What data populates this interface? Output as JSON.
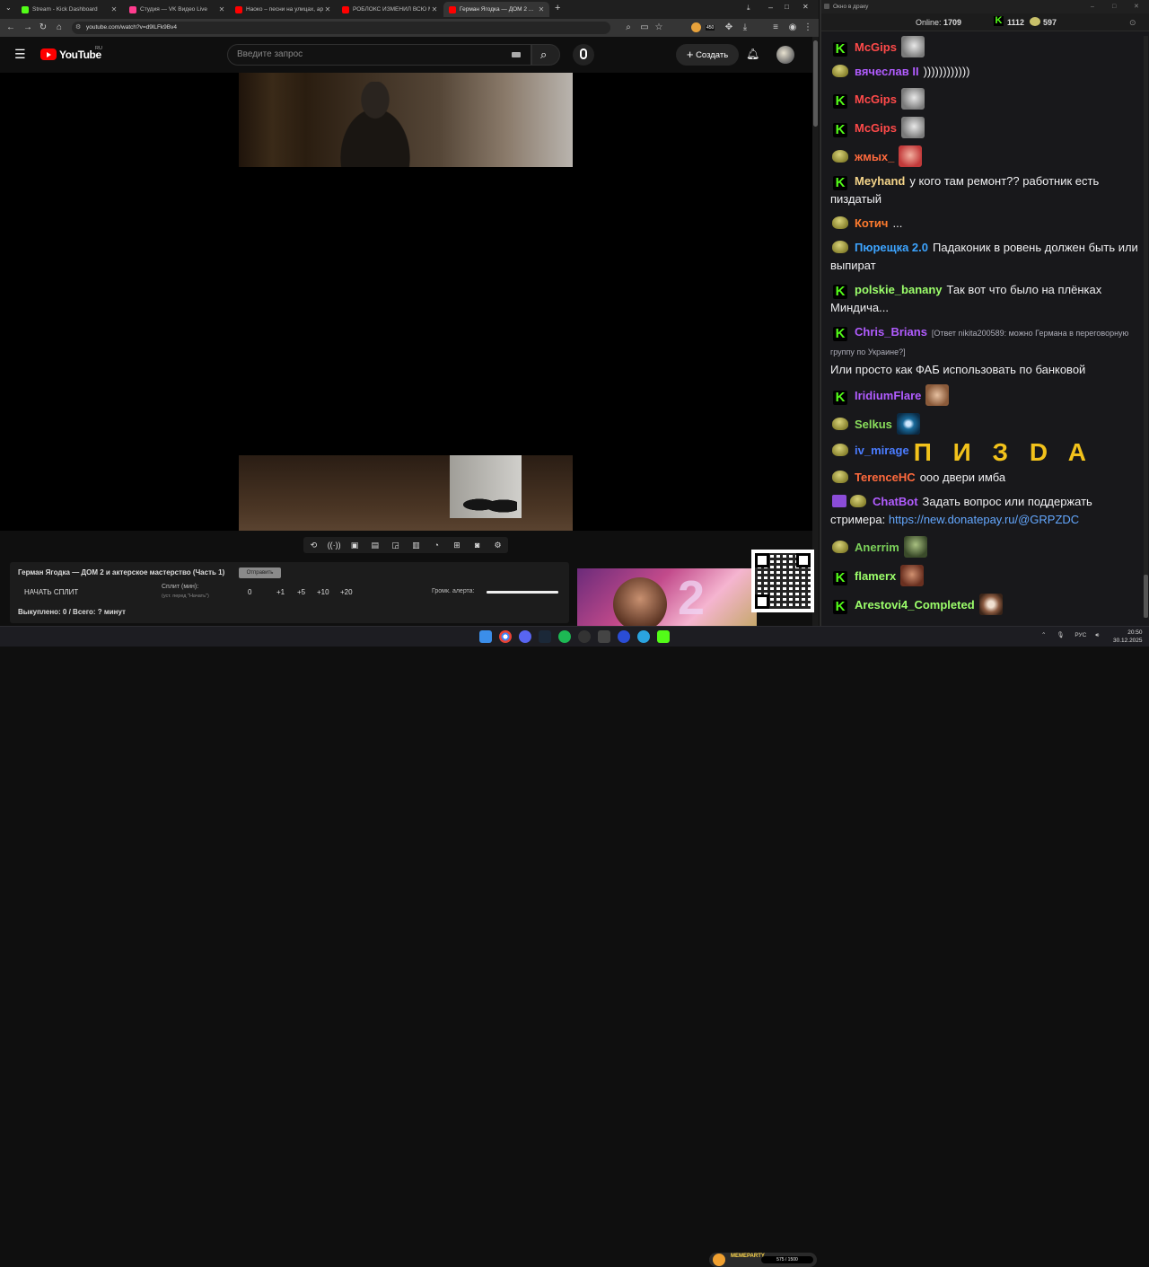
{
  "browser": {
    "tabs": [
      {
        "label": "Stream - Kick Dashboard",
        "icon": "kick-icon",
        "color": "#53fc18"
      },
      {
        "label": "Студия — VK Видео Live",
        "icon": "vk-video-icon",
        "color": "#ff3c8e"
      },
      {
        "label": "Наоко – песни на улицах, арс...",
        "icon": "youtube-icon",
        "color": "#ff0000"
      },
      {
        "label": "РОБЛОКС ИЗМЕНИЛ ВСЮ М...",
        "icon": "youtube-icon",
        "color": "#ff0000"
      },
      {
        "label": "Герман Ягодка — ДОМ 2 ...",
        "icon": "youtube-icon",
        "color": "#ff0000"
      }
    ],
    "url": "youtube.com/watch?v=d9lLFk9Bv4",
    "extension_badge": "450"
  },
  "youtube": {
    "wordmark": "YouTube",
    "region": "RU",
    "search_placeholder": "Введите запрос",
    "create_label": "Создать"
  },
  "split_panel": {
    "title": "Герман Ягодка — ДОМ 2 и актерское мастерство (Часть 1)",
    "title_button": "Отправить",
    "start_label": "НАЧАТЬ СПЛИТ",
    "split_label": "Сплит (мин):",
    "split_hint": "(уст. перед \"Начать\")",
    "split_value": "0",
    "increments": [
      "+1",
      "+5",
      "+10",
      "+20"
    ],
    "volume_label": "Громк. алерта:",
    "volume_level": 1.0,
    "paid_status": "Выкуплено: 0 / Всего: ? минут"
  },
  "meme_widget": {
    "title": "MEMEPARTY",
    "progress": "575 / 1500"
  },
  "chat": {
    "window_title": "Окно в драку",
    "online_label": "Online:",
    "online_count": "1709",
    "kick_count": "1112",
    "other_count": "597",
    "messages": [
      {
        "nick": "McGips",
        "nick_color": "#ff4a4a",
        "badge": "kick",
        "text": "",
        "emote": "mcgips-emote"
      },
      {
        "nick": "вячеслав II",
        "nick_color": "#b15cff",
        "badge": "sub",
        "text": "))))))))))))",
        "emote": ""
      },
      {
        "nick": "McGips",
        "nick_color": "#ff4a4a",
        "badge": "kick",
        "text": "",
        "emote": "mcgips-emote"
      },
      {
        "nick": "McGips",
        "nick_color": "#ff4a4a",
        "badge": "kick",
        "text": "",
        "emote": "mcgips-emote"
      },
      {
        "nick": "жмых_",
        "nick_color": "#ff6a3d",
        "badge": "sub",
        "text": "",
        "emote": "face-emote"
      },
      {
        "nick": "Meyhand",
        "nick_color": "#f5d58a",
        "badge": "kick",
        "text": "у кого там ремонт?? работник есть пиздатый",
        "emote": ""
      },
      {
        "nick": "Котич",
        "nick_color": "#ff7b2e",
        "badge": "sub",
        "text": "...",
        "emote": ""
      },
      {
        "nick": "Пюрещка 2.0",
        "nick_color": "#3da4ff",
        "badge": "sub",
        "text": "Падаконик в ровень должен быть или выпират",
        "emote": ""
      },
      {
        "nick": "polskie_banany",
        "nick_color": "#9cff6b",
        "badge": "kick",
        "text": "Так вот что было на плёнках Миндича...",
        "emote": ""
      },
      {
        "nick": "Chris_Brians",
        "nick_color": "#b15cff",
        "badge": "kick",
        "reply": "[Ответ nikita200589: можно Германа в переговорную группу по Украине?]",
        "text": "Или просто как ФАБ использовать по банковой",
        "emote": ""
      },
      {
        "nick": "IridiumFlare",
        "nick_color": "#b15cff",
        "badge": "kick",
        "text": "",
        "emote": "laugh-emote"
      },
      {
        "nick": "Selkus",
        "nick_color": "#8adf5c",
        "badge": "sub",
        "text": "",
        "emote": "eye-emote"
      },
      {
        "nick": "iv_mirage",
        "nick_color": "#4a7cff",
        "badge": "sub",
        "text": "П И З D A",
        "emote": ""
      },
      {
        "nick": "TerenceHC",
        "nick_color": "#ff6a3d",
        "badge": "sub",
        "text": "ооо двери имба",
        "emote": ""
      },
      {
        "nick": "ChatBot",
        "nick_color": "#b15cff",
        "badge": "bot",
        "text": "Задать вопрос или поддержать стримера:",
        "link": "https://new.donatepay.ru/@GRPZDC",
        "emote": ""
      },
      {
        "nick": "Anerrim",
        "nick_color": "#7bd05a",
        "badge": "sub",
        "text": "",
        "emote": "alien-emote"
      },
      {
        "nick": "flamerx",
        "nick_color": "#9cff6b",
        "badge": "kick",
        "text": "",
        "emote": "man-emote"
      },
      {
        "nick": "Arestovi4_Completed",
        "nick_color": "#9cff6b",
        "badge": "kick",
        "text": "",
        "emote": "grin-emote"
      }
    ]
  },
  "taskbar": {
    "lang": "РУС",
    "time": "20:50",
    "date": "30.12.2025"
  }
}
